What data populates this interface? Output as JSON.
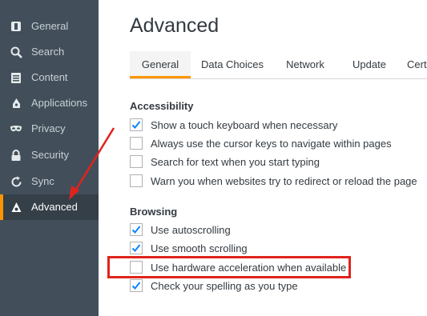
{
  "sidebar": {
    "items": [
      {
        "label": "General",
        "icon": "general-icon"
      },
      {
        "label": "Search",
        "icon": "search-icon"
      },
      {
        "label": "Content",
        "icon": "content-icon"
      },
      {
        "label": "Applications",
        "icon": "applications-icon"
      },
      {
        "label": "Privacy",
        "icon": "privacy-mask-icon"
      },
      {
        "label": "Security",
        "icon": "security-lock-icon"
      },
      {
        "label": "Sync",
        "icon": "sync-icon"
      },
      {
        "label": "Advanced",
        "icon": "advanced-icon",
        "active": true
      }
    ]
  },
  "page": {
    "title": "Advanced"
  },
  "tabs": [
    {
      "label": "General",
      "active": true
    },
    {
      "label": "Data Choices"
    },
    {
      "label": "Network"
    },
    {
      "label": "Update"
    },
    {
      "label": "Certificates"
    }
  ],
  "sections": {
    "accessibility": {
      "title": "Accessibility",
      "options": [
        {
          "label": "Show a touch keyboard when necessary",
          "checked": true
        },
        {
          "label": "Always use the cursor keys to navigate within pages",
          "checked": false
        },
        {
          "label": "Search for text when you start typing",
          "checked": false
        },
        {
          "label": "Warn you when websites try to redirect or reload the page",
          "checked": false
        }
      ]
    },
    "browsing": {
      "title": "Browsing",
      "options": [
        {
          "label": "Use autoscrolling",
          "checked": true
        },
        {
          "label": "Use smooth scrolling",
          "checked": true
        },
        {
          "label": "Use hardware acceleration when available",
          "checked": false,
          "highlighted": true
        },
        {
          "label": "Check your spelling as you type",
          "checked": true
        }
      ]
    }
  },
  "colors": {
    "accent": "#ff9400",
    "sidebar_bg": "#424f5a",
    "annotation_red": "#e0231b",
    "check_blue": "#0a84ff"
  }
}
